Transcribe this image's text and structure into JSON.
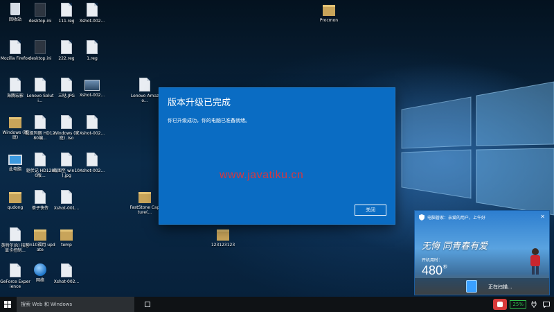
{
  "desktop": {
    "icons": [
      {
        "label": "回收站",
        "kind": "recycle"
      },
      {
        "label": "desktop.ini",
        "kind": "dark"
      },
      {
        "label": "111.reg",
        "kind": "file"
      },
      {
        "label": "Xshot-002...",
        "kind": "file"
      },
      {
        "label": "Procmon",
        "kind": "folder"
      },
      {
        "label": "Mozilla Firefox",
        "kind": "file"
      },
      {
        "label": "desktop.ini",
        "kind": "dark"
      },
      {
        "label": "222.reg",
        "kind": "file"
      },
      {
        "label": "1.reg",
        "kind": "file"
      },
      {
        "label": "海腾宏影",
        "kind": "file"
      },
      {
        "label": "Lenovo Soluti...",
        "kind": "file"
      },
      {
        "label": "三哒.JPG",
        "kind": "file"
      },
      {
        "label": "Xshot-002...",
        "kind": "image"
      },
      {
        "label": "Lenovo Amazo...",
        "kind": "file"
      },
      {
        "label": "Windows (家庭)",
        "kind": "folder"
      },
      {
        "label": "超级玛丽 HD1280编...",
        "kind": "file"
      },
      {
        "label": "Windows (家庭) .iso",
        "kind": "file"
      },
      {
        "label": "Xshot-002...",
        "kind": "file"
      },
      {
        "label": "此电脑",
        "kind": "monitor"
      },
      {
        "label": "驱伏记 HD1280版...",
        "kind": "file"
      },
      {
        "label": "截图至 win10 ).jpg",
        "kind": "file"
      },
      {
        "label": "Xshot-002...",
        "kind": "file"
      },
      {
        "label": "qudong",
        "kind": "folder"
      },
      {
        "label": "茶子快传",
        "kind": "file"
      },
      {
        "label": "Xshot-001...",
        "kind": "file"
      },
      {
        "label": "FastStone Capture(...",
        "kind": "folder"
      },
      {
        "label": "英特尔(R) 核芯显卡控制...",
        "kind": "file"
      },
      {
        "label": "win10福用 update",
        "kind": "folder"
      },
      {
        "label": "temp",
        "kind": "folder"
      },
      {
        "label": "123123123",
        "kind": "folder"
      },
      {
        "label": "GeForce Experience",
        "kind": "file"
      },
      {
        "label": "网络",
        "kind": "globe"
      },
      {
        "label": "Xshot-002...",
        "kind": "file"
      }
    ]
  },
  "dialog": {
    "title": "版本升级已完成",
    "message": "你已升级成功，你的电脑已准备就绪。",
    "close_label": "关闭"
  },
  "watermark": "www.javatiku.cn",
  "popup": {
    "header": "电脑管家：亲爱的用户，上午好",
    "banner": "无悔 同青春有爱",
    "boot_label": "开机用时：",
    "boot_time": "480",
    "boot_unit": "秒",
    "scan_status": "正在扫描..."
  },
  "taskbar": {
    "search_placeholder": "搜索 Web 和 Windows",
    "battery": "25%"
  }
}
